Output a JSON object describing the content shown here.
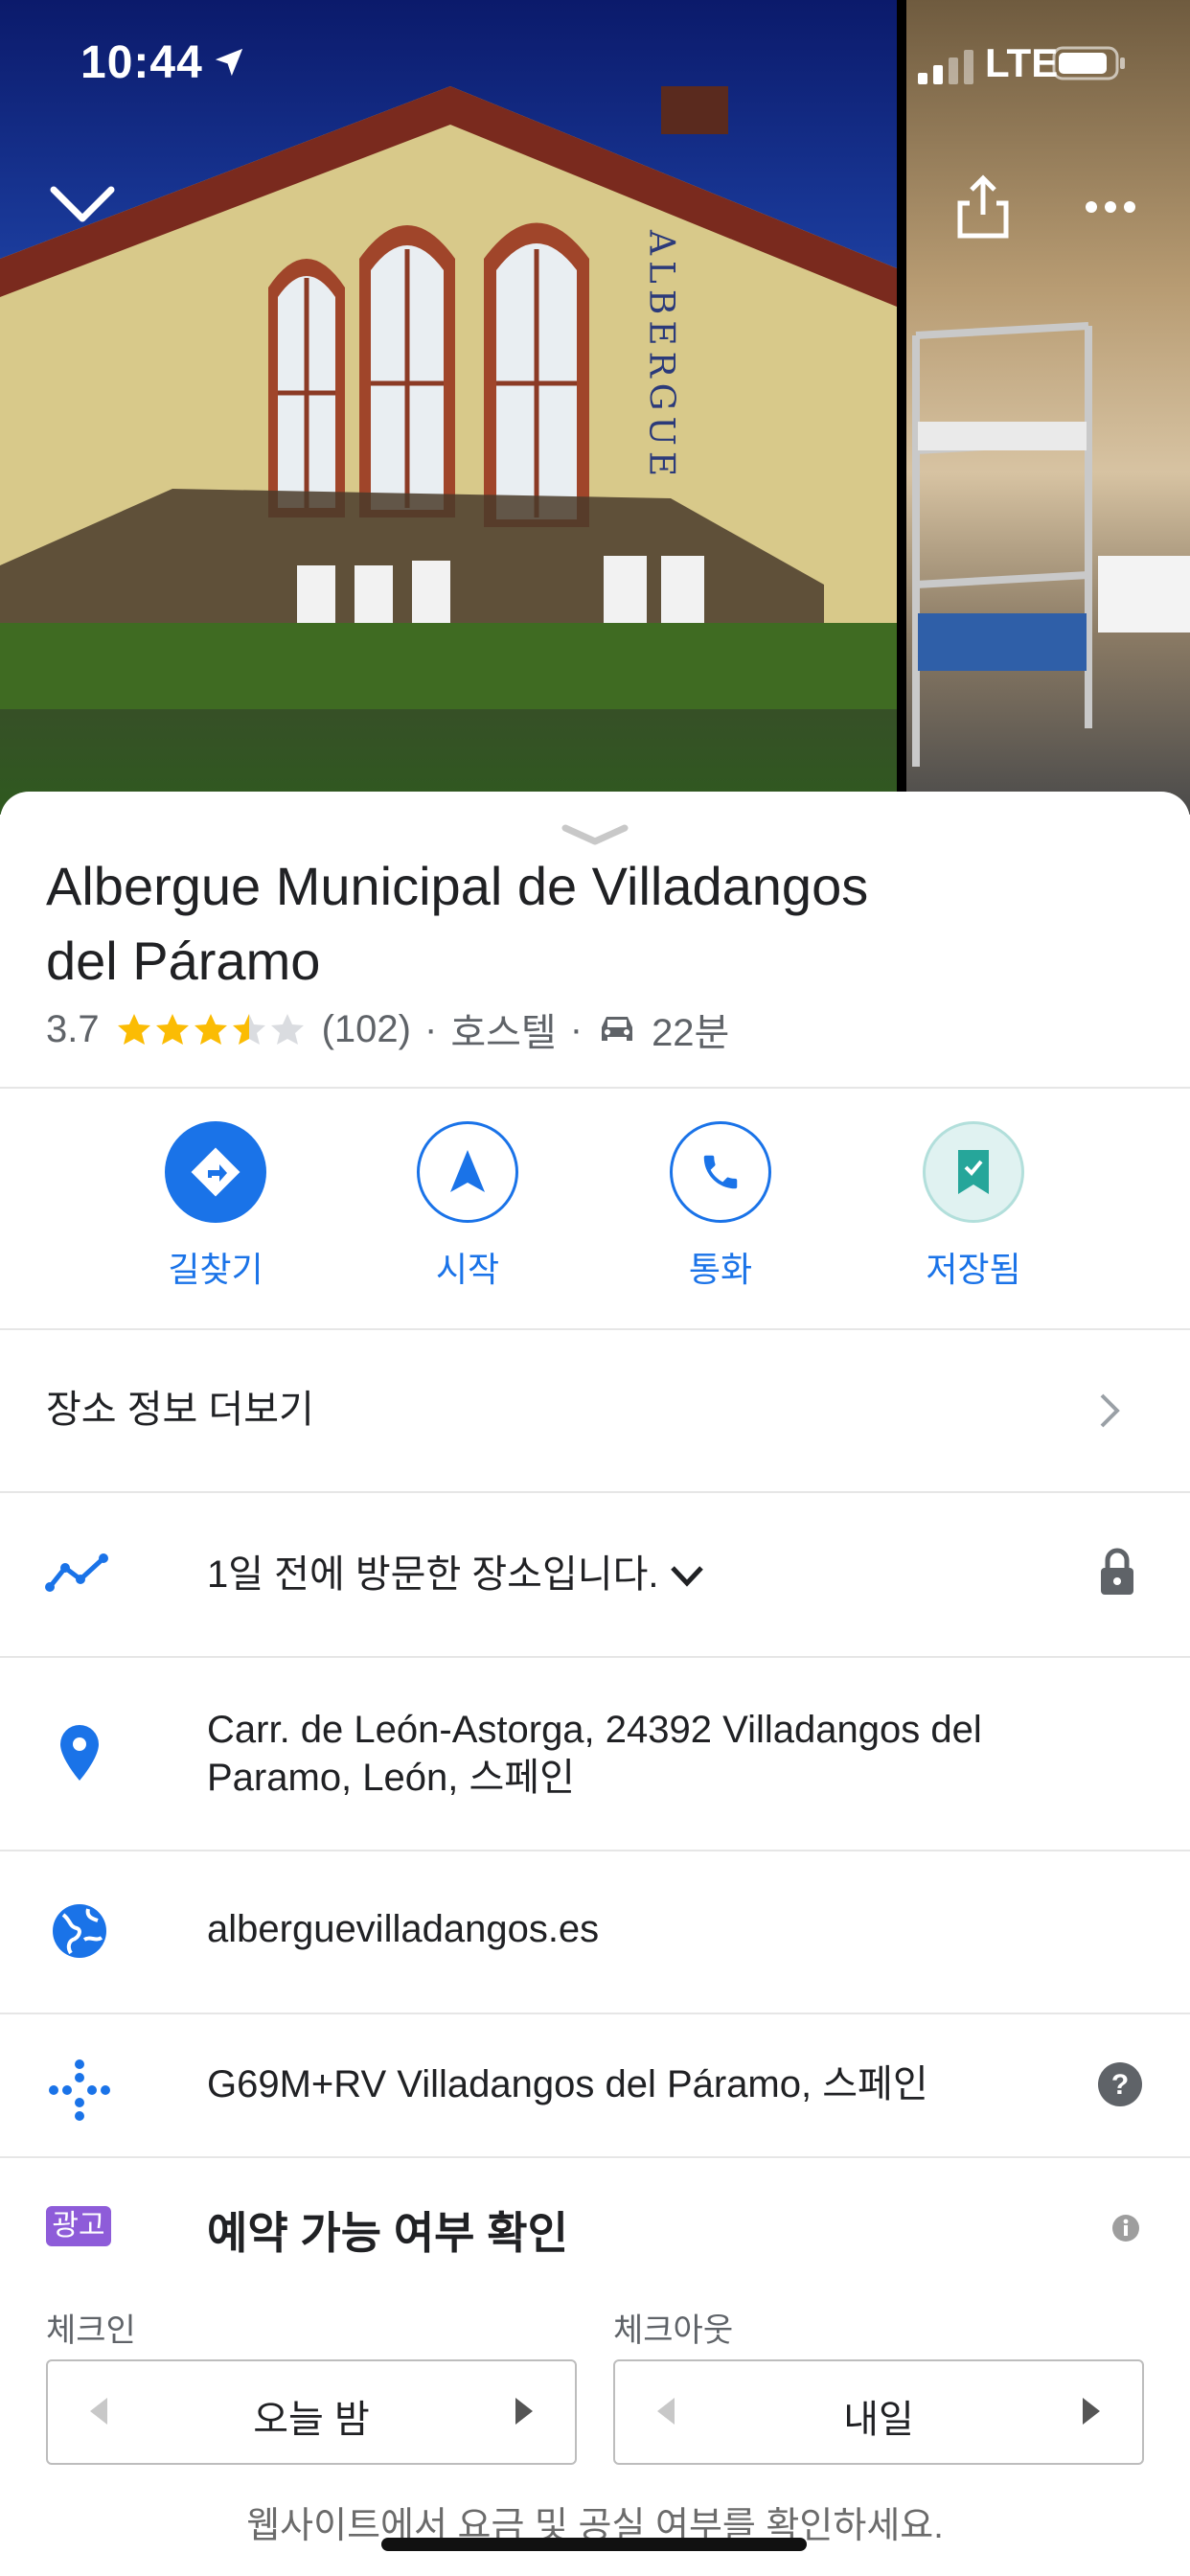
{
  "status_bar": {
    "time": "10:44",
    "network": "LTE"
  },
  "place": {
    "name_line1": "Albergue Municipal de Villadangos",
    "name_line2": "del Páramo",
    "rating": "3.7",
    "stars": 3.5,
    "reviews": "(102)",
    "category": "호스텔",
    "drive_time": "22분",
    "photo_sign": "ALBERGUE"
  },
  "actions": [
    {
      "label": "길찾기",
      "icon": "directions-icon"
    },
    {
      "label": "시작",
      "icon": "navigation-icon"
    },
    {
      "label": "통화",
      "icon": "phone-icon"
    },
    {
      "label": "저장됨",
      "icon": "saved-bookmark-icon"
    }
  ],
  "rows": {
    "more_info": "장소 정보 더보기",
    "visited": "1일 전에 방문한 장소입니다.",
    "address_line1": "Carr. de León-Astorga, 24392 Villadangos del",
    "address_line2": "Paramo, León, 스페인",
    "website": "alberguevilladangos.es",
    "plus_code": "G69M+RV Villadangos del Páramo, 스페인"
  },
  "ad": {
    "badge": "광고",
    "title": "예약 가능 여부 확인",
    "checkin_label": "체크인",
    "checkin_value": "오늘 밤",
    "checkout_label": "체크아웃",
    "checkout_value": "내일",
    "footer": "웹사이트에서 요금 및 공실 여부를 확인하세요."
  },
  "colors": {
    "accent": "#1a73e8",
    "star": "#fbbc04",
    "saved_bg": "#e0f2f1",
    "saved_icon": "#26a69a"
  }
}
